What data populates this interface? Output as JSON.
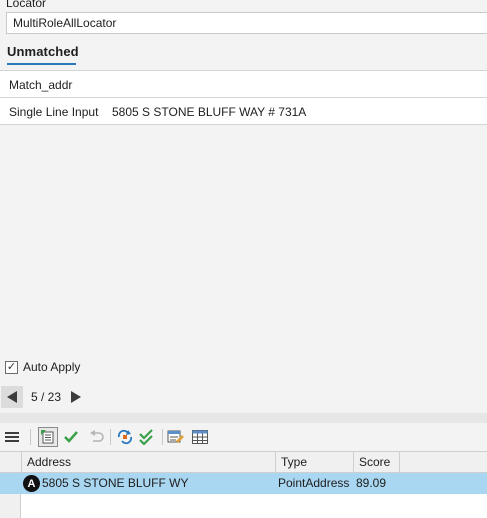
{
  "locator": {
    "label": "Locator",
    "value": "MultiRoleAllLocator"
  },
  "tabs": [
    {
      "label": "Unmatched",
      "selected": true
    }
  ],
  "fields": [
    {
      "name": "Match_addr",
      "value": ""
    },
    {
      "name": "Single Line Input",
      "value": "5805 S STONE BLUFF WAY # 731A"
    }
  ],
  "auto_apply": {
    "label": "Auto Apply",
    "checked": true
  },
  "pager": {
    "text": "5 / 23",
    "current": 5,
    "total": 23
  },
  "toolbar": {
    "icons": [
      "menu-icon",
      "zoom-to-candidate-icon",
      "match-icon",
      "unmatch-icon",
      "rematch-icon",
      "verify-icon",
      "edit-fields-icon",
      "table-icon"
    ]
  },
  "candidates_table": {
    "headers": [
      "",
      "Address",
      "Type",
      "Score",
      ""
    ],
    "rows": [
      {
        "rank": "A",
        "address": "5805 S STONE BLUFF WY",
        "type": "PointAddress",
        "score": "89.09"
      }
    ]
  },
  "colors": {
    "accent": "#2a79be",
    "selected_row": "#a9d6f0",
    "match_green": "#3aa14a"
  }
}
